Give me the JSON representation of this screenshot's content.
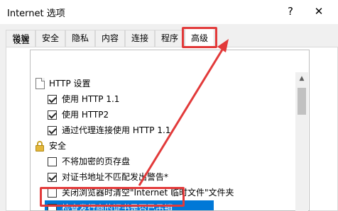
{
  "window": {
    "title": "Internet 选项",
    "help_label": "?",
    "close_label": "✕"
  },
  "tabs": [
    {
      "label": "常规"
    },
    {
      "label": "安全"
    },
    {
      "label": "隐私"
    },
    {
      "label": "内容"
    },
    {
      "label": "连接"
    },
    {
      "label": "程序"
    },
    {
      "label": "高级",
      "active": true
    }
  ],
  "settings_group_label": "设置",
  "settings": {
    "http_header": "HTTP 设置",
    "use_http11": "使用 HTTP 1.1",
    "use_http2": "使用 HTTP2",
    "proxy_http11": "通过代理连接使用 HTTP 1.1",
    "security_header": "安全",
    "no_save_encrypted": "不将加密的页存盘",
    "cert_mismatch": "对证书地址不匹配发出警告*",
    "clear_temp_files": "关闭浏览器时清空\"Internet 临时文件\"文件夹",
    "check_publisher_revocation": "检查发行商的证书是否已吊销"
  },
  "states": {
    "use_http11": true,
    "use_http2": true,
    "proxy_http11": true,
    "no_save_encrypted": false,
    "cert_mismatch": true,
    "clear_temp_files": false,
    "check_publisher_revocation": false
  },
  "colors": {
    "highlight": "#e23a3a",
    "selection": "#0078d7"
  }
}
